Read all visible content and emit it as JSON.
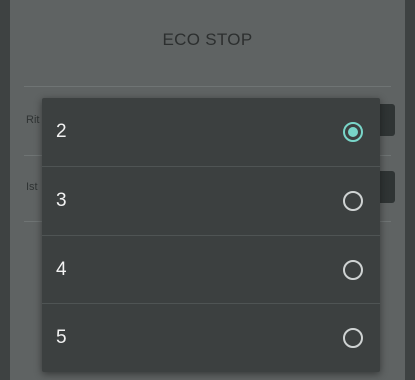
{
  "screen": {
    "title": "ECO STOP",
    "rows": [
      {
        "label": "Rit"
      },
      {
        "label": "Ist"
      }
    ]
  },
  "dropdown": {
    "options": [
      {
        "label": "2",
        "selected": true
      },
      {
        "label": "3",
        "selected": false
      },
      {
        "label": "4",
        "selected": false
      },
      {
        "label": "5",
        "selected": false
      }
    ],
    "accent_color": "#79d6c9",
    "radio_icon": "radio-button-icon"
  }
}
